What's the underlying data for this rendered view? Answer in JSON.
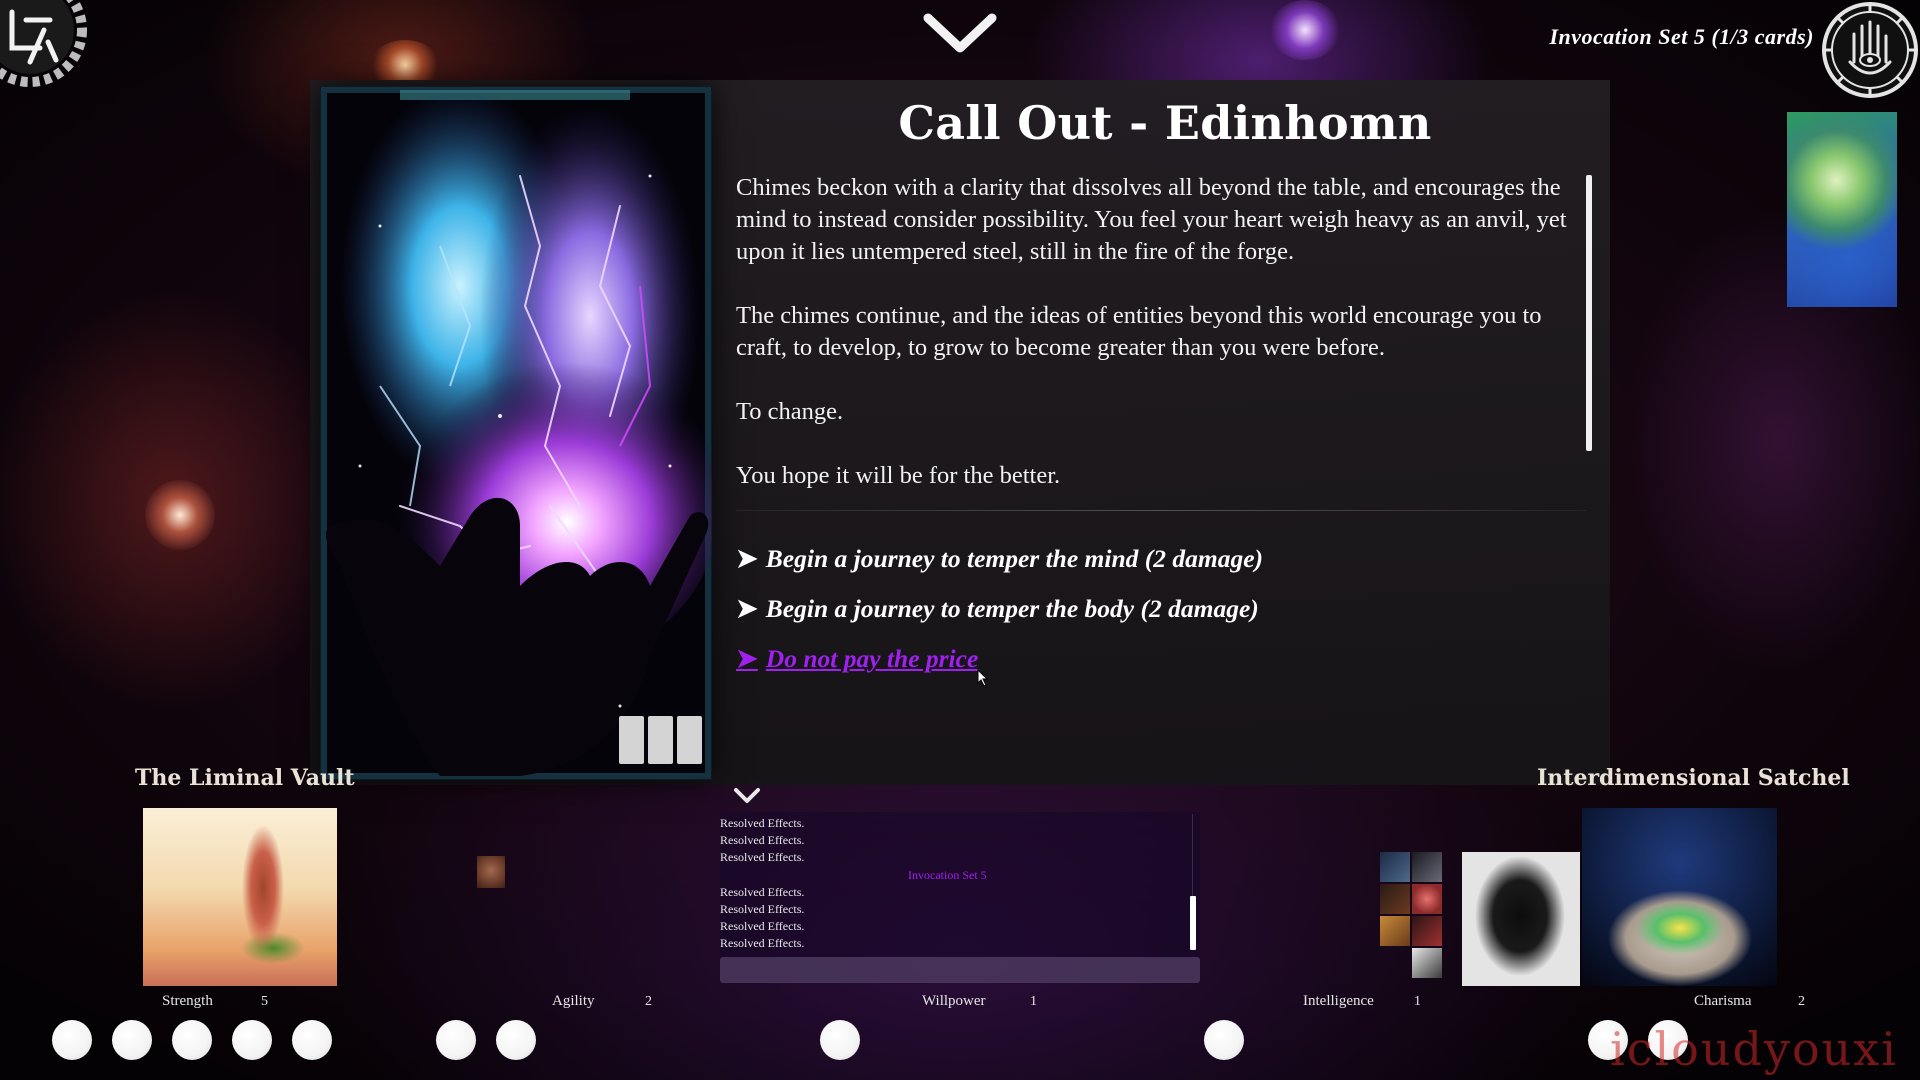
{
  "header": {
    "invocation_title": "Invocation Set  5 (1/3 cards)"
  },
  "event": {
    "title": "Call Out - Edinhomn",
    "paragraphs": [
      "Chimes beckon with a clarity that dissolves all beyond the table, and encourages the mind to instead consider possibility. You feel your heart weigh heavy as an anvil, yet upon it lies untempered steel, still in the fire of the forge.",
      "The chimes continue, and the ideas of entities beyond this world encourage you to craft, to develop, to grow to become greater than you were before.",
      "To change.",
      "You hope it will be for the better."
    ],
    "choices": [
      {
        "label": "Begin a journey to temper the mind (2 damage)",
        "hover": false
      },
      {
        "label": "Begin a journey to temper the body (2 damage)",
        "hover": false
      },
      {
        "label": "Do not pay the price",
        "hover": true
      }
    ],
    "choice_arrow": "➤"
  },
  "areas": {
    "left_label": "The Liminal Vault",
    "right_label": "Interdimensional Satchel"
  },
  "log": {
    "lines_top": [
      "Resolved Effects.",
      "Resolved Effects.",
      "Resolved Effects."
    ],
    "lines_bottom": [
      "Resolved Effects.",
      "Resolved Effects.",
      "Resolved Effects.",
      "Resolved Effects."
    ],
    "set_label": "Invocation Set 5"
  },
  "stats": [
    {
      "name": "Strength",
      "value": "5",
      "orbs": 5
    },
    {
      "name": "Agility",
      "value": "2",
      "orbs": 2
    },
    {
      "name": "Willpower",
      "value": "1",
      "orbs": 1
    },
    {
      "name": "Intelligence",
      "value": "1",
      "orbs": 1
    },
    {
      "name": "Charisma",
      "value": "2",
      "orbs": 2
    }
  ],
  "watermark": "icloudyouxi",
  "colors": {
    "accent_purple": "#a020f0",
    "panel": "#1f1c20"
  }
}
